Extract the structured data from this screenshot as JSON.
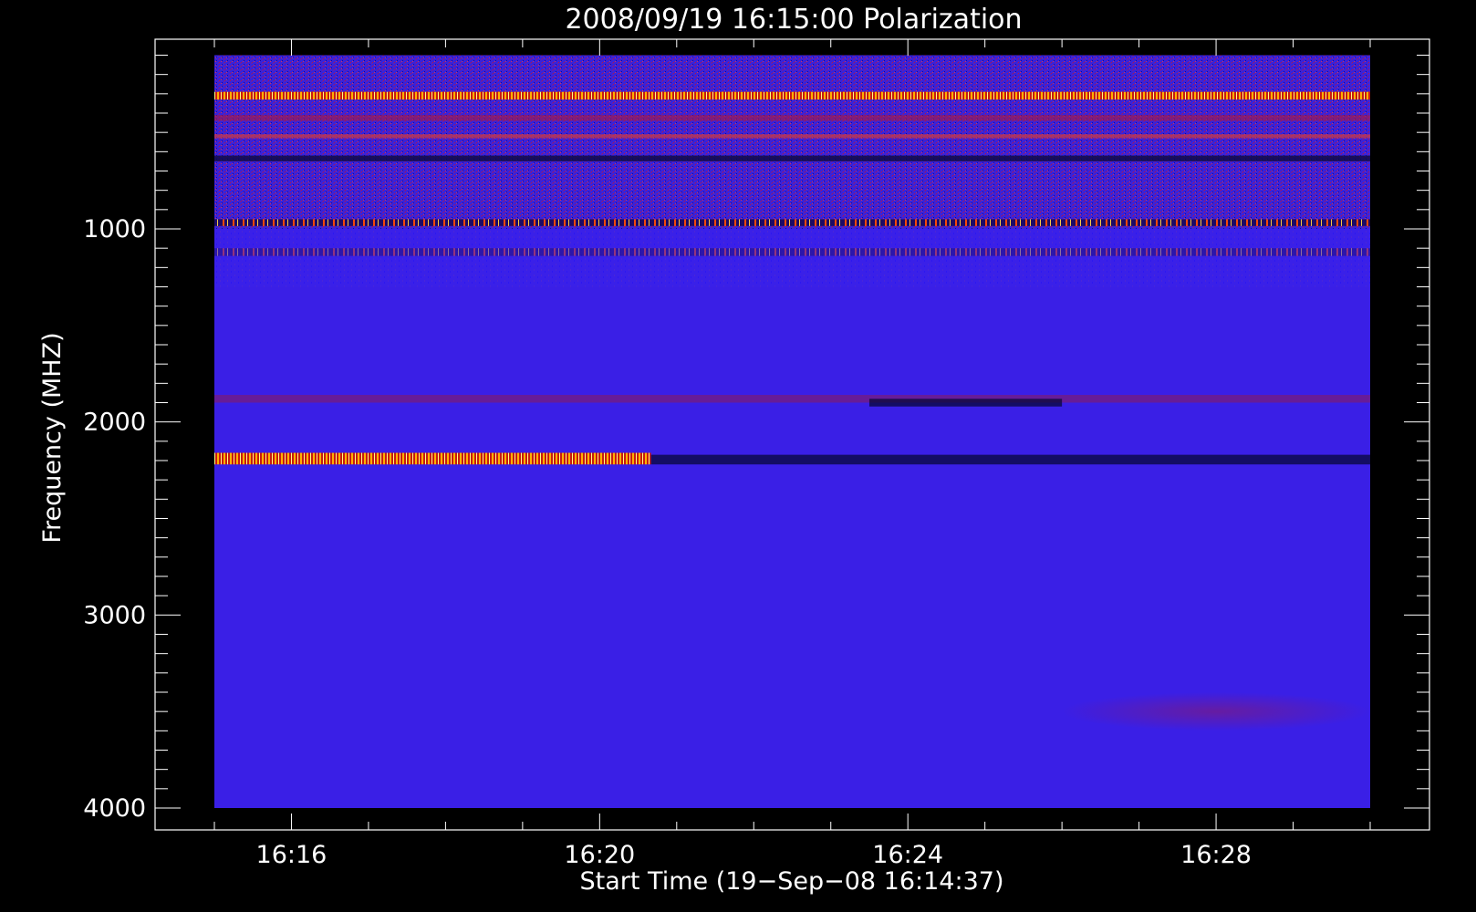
{
  "chart_data": {
    "type": "heatmap",
    "title": "2008/09/19 16:15:00 Polarization",
    "xlabel": "Start Time (19−Sep−08 16:14:37)",
    "ylabel": "Frequency (MHZ)",
    "x_start": "16:15:00",
    "x_end": "16:30:00",
    "ylim": [
      0,
      4000
    ],
    "y_reversed": true,
    "data_freq_range": [
      100,
      4000
    ],
    "x_ticks": [
      "16:16",
      "16:20",
      "16:24",
      "16:28"
    ],
    "y_ticks": [
      "1000",
      "2000",
      "3000",
      "4000"
    ],
    "x_minor_step_seconds": 60,
    "y_minor_step_mhz": 100,
    "background_color": "#3a1fe6",
    "colormap": [
      "#000000",
      "#1010c8",
      "#3a1fe6",
      "#b0102a",
      "#ff2a00",
      "#ff9a00",
      "#ffff66",
      "#ffffff"
    ],
    "bands": [
      {
        "freq": [
          120,
          200
        ],
        "time": [
          "16:15:00",
          "16:30:00"
        ],
        "intensity": "high-noise"
      },
      {
        "freq": [
          290,
          330
        ],
        "time": [
          "16:15:00",
          "16:30:00"
        ],
        "intensity": "very-high"
      },
      {
        "freq": [
          410,
          440
        ],
        "time": [
          "16:15:00",
          "16:30:00"
        ],
        "intensity": "medium"
      },
      {
        "freq": [
          510,
          530
        ],
        "time": [
          "16:15:00",
          "16:30:00"
        ],
        "intensity": "high"
      },
      {
        "freq": [
          620,
          650
        ],
        "time": [
          "16:15:00",
          "16:30:00"
        ],
        "intensity": "dark-line"
      },
      {
        "freq": [
          950,
          985
        ],
        "time": [
          "16:15:00",
          "16:30:00"
        ],
        "intensity": "high-sporadic"
      },
      {
        "freq": [
          1100,
          1140
        ],
        "time": [
          "16:15:00",
          "16:30:00"
        ],
        "intensity": "medium-sporadic"
      },
      {
        "freq": [
          1860,
          1900
        ],
        "time": [
          "16:15:00",
          "16:30:00"
        ],
        "intensity": "low"
      },
      {
        "freq": [
          1880,
          1920
        ],
        "time": [
          "16:23:30",
          "16:26:00"
        ],
        "intensity": "dark-line"
      },
      {
        "freq": [
          2160,
          2220
        ],
        "time": [
          "16:15:00",
          "16:20:40"
        ],
        "intensity": "very-high"
      },
      {
        "freq": [
          2170,
          2220
        ],
        "time": [
          "16:20:40",
          "16:30:00"
        ],
        "intensity": "dark-line"
      },
      {
        "freq": [
          3400,
          3600
        ],
        "time": [
          "16:26:00",
          "16:30:00"
        ],
        "intensity": "low-diffuse"
      }
    ]
  }
}
